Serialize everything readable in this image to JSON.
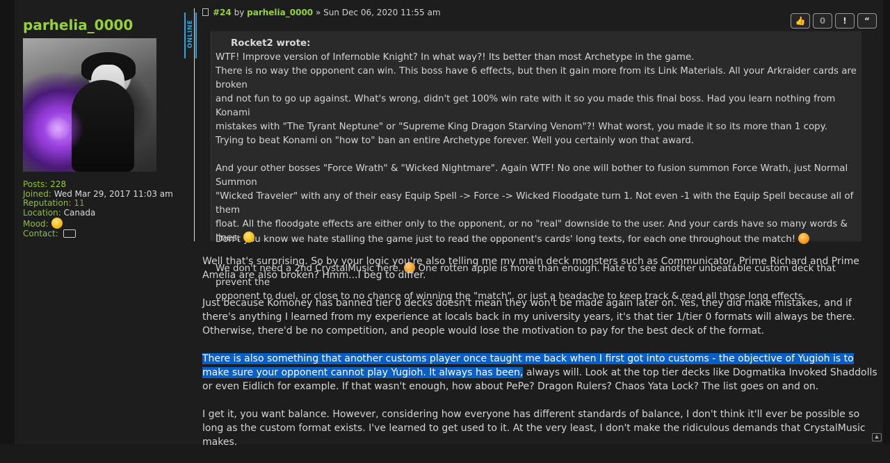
{
  "user": {
    "name": "parhelia_0000",
    "status": "ONLINE",
    "stats": [
      {
        "label": "Posts:",
        "value": "228",
        "style": "green"
      },
      {
        "label": "Joined:",
        "value": "Wed Mar 29, 2017 11:03 am",
        "style": "normal"
      },
      {
        "label": "Reputation:",
        "value": "11",
        "style": "dim"
      },
      {
        "label": "Location:",
        "value": "Canada",
        "style": "normal"
      }
    ],
    "mood_label": "Mood:",
    "mood_icon": "smiley-icon",
    "contact_label": "Contact:",
    "contact_icon": "chat-bubble-icon"
  },
  "post": {
    "number": "#24",
    "by": "by",
    "author": "parhelia_0000",
    "date": "» Sun Dec 06, 2020 11:55 am",
    "actions": {
      "like": "👍",
      "count": "0",
      "report": "!",
      "quote": "“"
    }
  },
  "quote": {
    "author": "Rocket2 wrote:",
    "lines": [
      "WTF! Improve version of Infernoble Knight? In what way?! Its better than most Archetype in the game.",
      "There is no way the opponent can win. This boss have 6 effects, but then it gain more from its Link Materials. All your Arkraider cards are broken",
      "and not fun to go up against. What's wrong, didn't get 100% win rate with it so you made this final boss. Had you learn nothing from Konami",
      "mistakes with \"The Tyrant Neptune\" or \"Supreme King Dragon Starving Venom\"?! What worst, you made it so its more than 1 copy.",
      "Trying to beat Konami on \"how to\" ban an entire Archetype forever. Well you certainly won that award.",
      "",
      "And your other bosses \"Force Wrath\" & \"Wicked Nightmare\". Again WTF! No one will bother to fusion summon Force Wrath, just Normal Summon",
      "\"Wicked Traveler\" with any of their easy Equip Spell -> Force -> Wicked Floodgate turn 1. Not even -1 with the Equip Spell because all of them",
      "float. All the floodgate effects are either only to the opponent, or no \"real\" downside to the user. And your cards have so many words & lines.",
      "Don't you know we hate stalling the game just to read the opponent's cards' long texts, for each one throughout the match!",
      "",
      "We don't need a 2nd CrystalMusic here.",
      "One rotten apple is more than enough. Hate to see another unbeatable custom deck that prevent the",
      "opponent to duel, or close to no chance of winning the \"match\", or just a headache to keep track & read all those long effects."
    ]
  },
  "body": {
    "p1": "Well that's surprising. So by your logic you're also telling me my main deck monsters such as Communicator, Prime Richard and Prime Amelia are also broken? Hmm...I beg to differ.",
    "p2": "Just because Komoney has banned tier 0 decks doesn't mean they won't be made again later on. Yes, they did make mistakes, and if there's anything I learned from my experience at locals back in my university years, it's that tier 1/tier 0 formats will always be there. Otherwise, there'd be no competition, and people would lose the motivation to pay for the best deck of the format.",
    "p3_highlight": "There is also something that another customs player once taught me back when I first got into customs - the objective of Yugioh is to make sure your opponent cannot play Yugioh. It always has been,",
    "p3_rest": " always will. Look at the top tier decks like Dogmatika Invoked Shaddolls or even Eidlich for example. If that wasn't enough, how about PePe? Dragon Rulers? Chaos Yata Lock? The list goes on and on.",
    "p4": "I get it, you want balance. However, considering how everyone has different standards of balance, I don't think it'll ever be possible so long as the custom format exists. I've learned to get used to it. At the very least, I don't make the ridiculous demands that CrystalMusic makes."
  },
  "colors": {
    "accent_green": "#96d13a",
    "online_blue": "#2aa7e0",
    "selection": "#0a5fc7"
  }
}
